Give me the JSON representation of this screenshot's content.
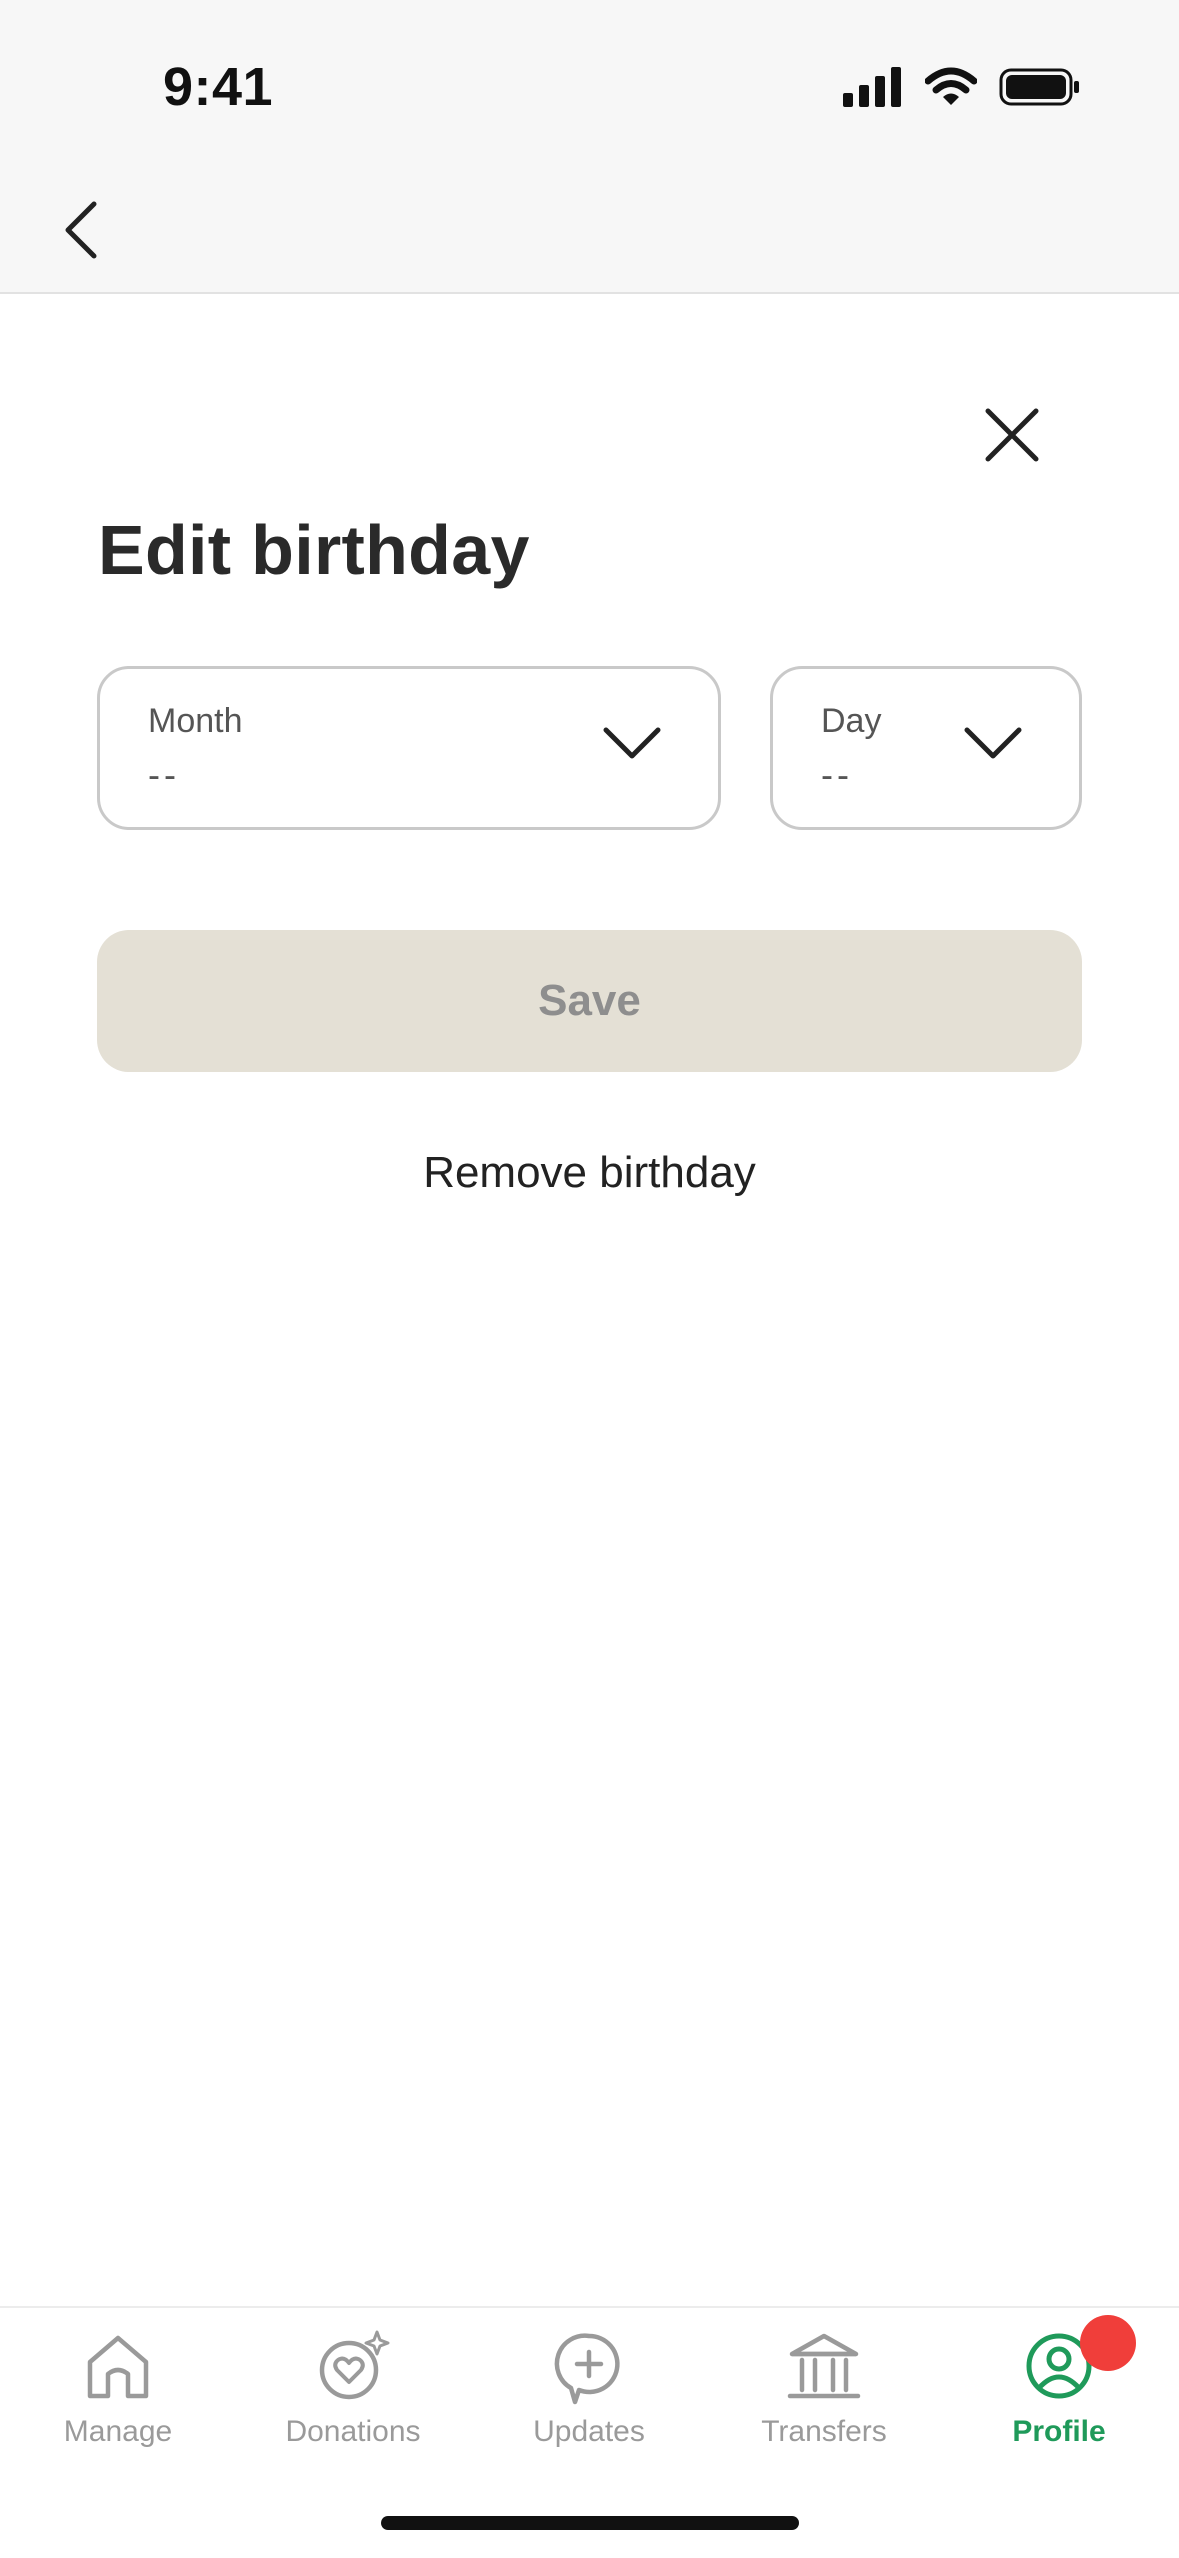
{
  "status_bar": {
    "time": "9:41"
  },
  "modal": {
    "title": "Edit birthday",
    "month_field": {
      "label": "Month",
      "value": "--"
    },
    "day_field": {
      "label": "Day",
      "value": "--"
    },
    "save_label": "Save",
    "remove_label": "Remove birthday"
  },
  "tabs": [
    {
      "label": "Manage",
      "icon": "home-icon",
      "active": false
    },
    {
      "label": "Donations",
      "icon": "heart-sparkle-icon",
      "active": false
    },
    {
      "label": "Updates",
      "icon": "plus-bubble-icon",
      "active": false
    },
    {
      "label": "Transfers",
      "icon": "bank-icon",
      "active": false
    },
    {
      "label": "Profile",
      "icon": "profile-icon",
      "active": true
    }
  ],
  "colors": {
    "accent": "#1f9a5a",
    "save_disabled_bg": "#e4e0d5",
    "badge": "#f03e3a"
  }
}
